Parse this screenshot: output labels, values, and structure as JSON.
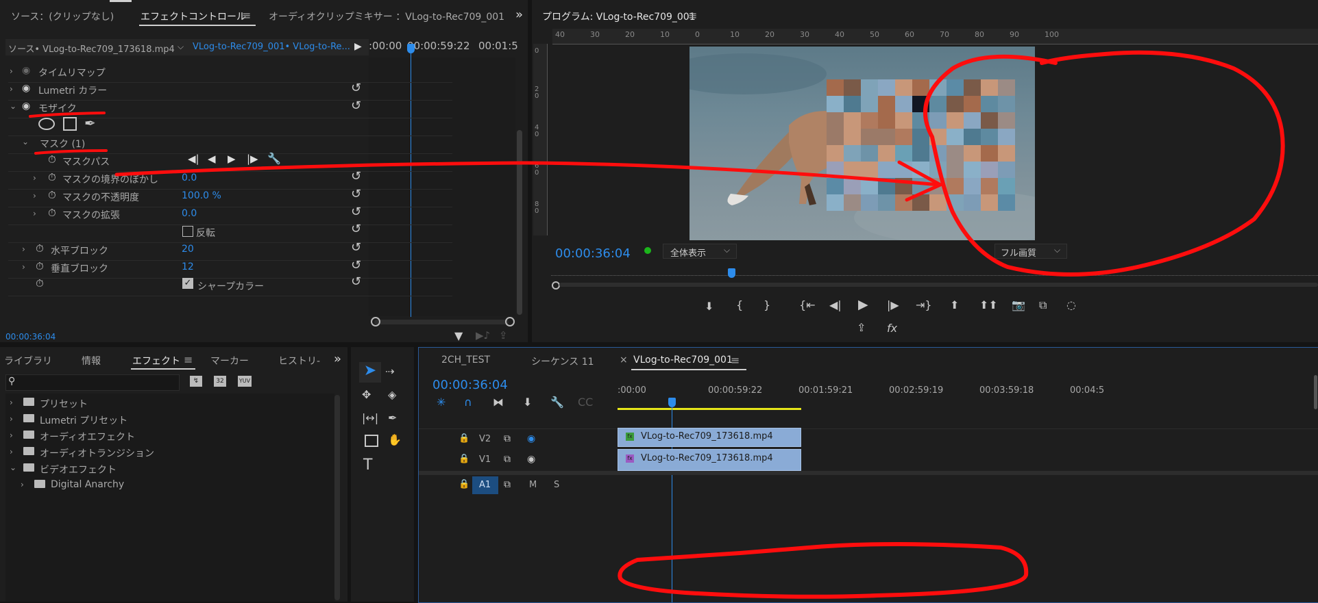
{
  "source_panel": {
    "tabs": [
      "ソース：(クリップなし)",
      "エフェクトコントロール",
      "オーディオクリップミキサー ：VLog-to-Rec709_001"
    ],
    "source_clip": "ソース• VLog-to-Rec709_173618.mp4",
    "sequence_clip": "VLog-to-Rec709_001• VLog-to-Re...",
    "ruler": [
      ":00:00",
      "00:00:59:22",
      "00:01:5"
    ],
    "effects": [
      {
        "label": "タイムリマップ"
      },
      {
        "label": "Lumetri カラー"
      },
      {
        "label": "モザイク"
      }
    ],
    "mask_label": "マスク (1)",
    "mask_props": [
      {
        "label": "マスクパス",
        "value": ""
      },
      {
        "label": "マスクの境界のぼかし",
        "value": "0.0"
      },
      {
        "label": "マスクの不透明度",
        "value": "100.0 %"
      },
      {
        "label": "マスクの拡張",
        "value": "0.0"
      }
    ],
    "invert_label": "反転",
    "h_block_label": "水平ブロック",
    "h_block_value": "20",
    "v_block_label": "垂直ブロック",
    "v_block_value": "12",
    "sharp_label": "シャープカラー",
    "timecode": "00:00:36:04"
  },
  "program_panel": {
    "title": "プログラム: VLog-to-Rec709_001",
    "ruler_h": [
      "40",
      "30",
      "20",
      "10",
      "0",
      "10",
      "20",
      "30",
      "40",
      "50",
      "60",
      "70",
      "80",
      "90",
      "100"
    ],
    "ruler_v": [
      "0",
      "2 0",
      "4 0",
      "6 0",
      "8 0"
    ],
    "timecode": "00:00:36:04",
    "fit": "全体表示",
    "quality": "フル画質"
  },
  "effects_panel": {
    "tabs": [
      "ライブラリ",
      "情報",
      "エフェクト",
      "マーカー",
      "ヒストリ-"
    ],
    "search_placeholder": "",
    "items": [
      {
        "label": "プリセット"
      },
      {
        "label": "Lumetri プリセット"
      },
      {
        "label": "オーディオエフェクト"
      },
      {
        "label": "オーディオトランジション"
      },
      {
        "label": "ビデオエフェクト"
      },
      {
        "label": "Digital Anarchy"
      }
    ]
  },
  "timeline": {
    "tabs": [
      "2CH_TEST",
      "シーケンス 11",
      "VLog-to-Rec709_001"
    ],
    "timecode": "00:00:36:04",
    "ruler": [
      ":00:00",
      "00:00:59:22",
      "00:01:59:21",
      "00:02:59:19",
      "00:03:59:18",
      "00:04:5"
    ],
    "tracks": [
      {
        "name": "V2",
        "clip": "VLog-to-Rec709_173618.mp4"
      },
      {
        "name": "V1",
        "clip": "VLog-to-Rec709_173618.mp4"
      },
      {
        "name": "A1",
        "clip": ""
      }
    ],
    "track_letters": [
      "M",
      "S"
    ]
  },
  "colors": {
    "accent_blue": "#2d8ceb",
    "annotation_red": "#ff0d0d",
    "clip_blue": "#8aabd6",
    "work_area_yellow": "#e6e619"
  }
}
